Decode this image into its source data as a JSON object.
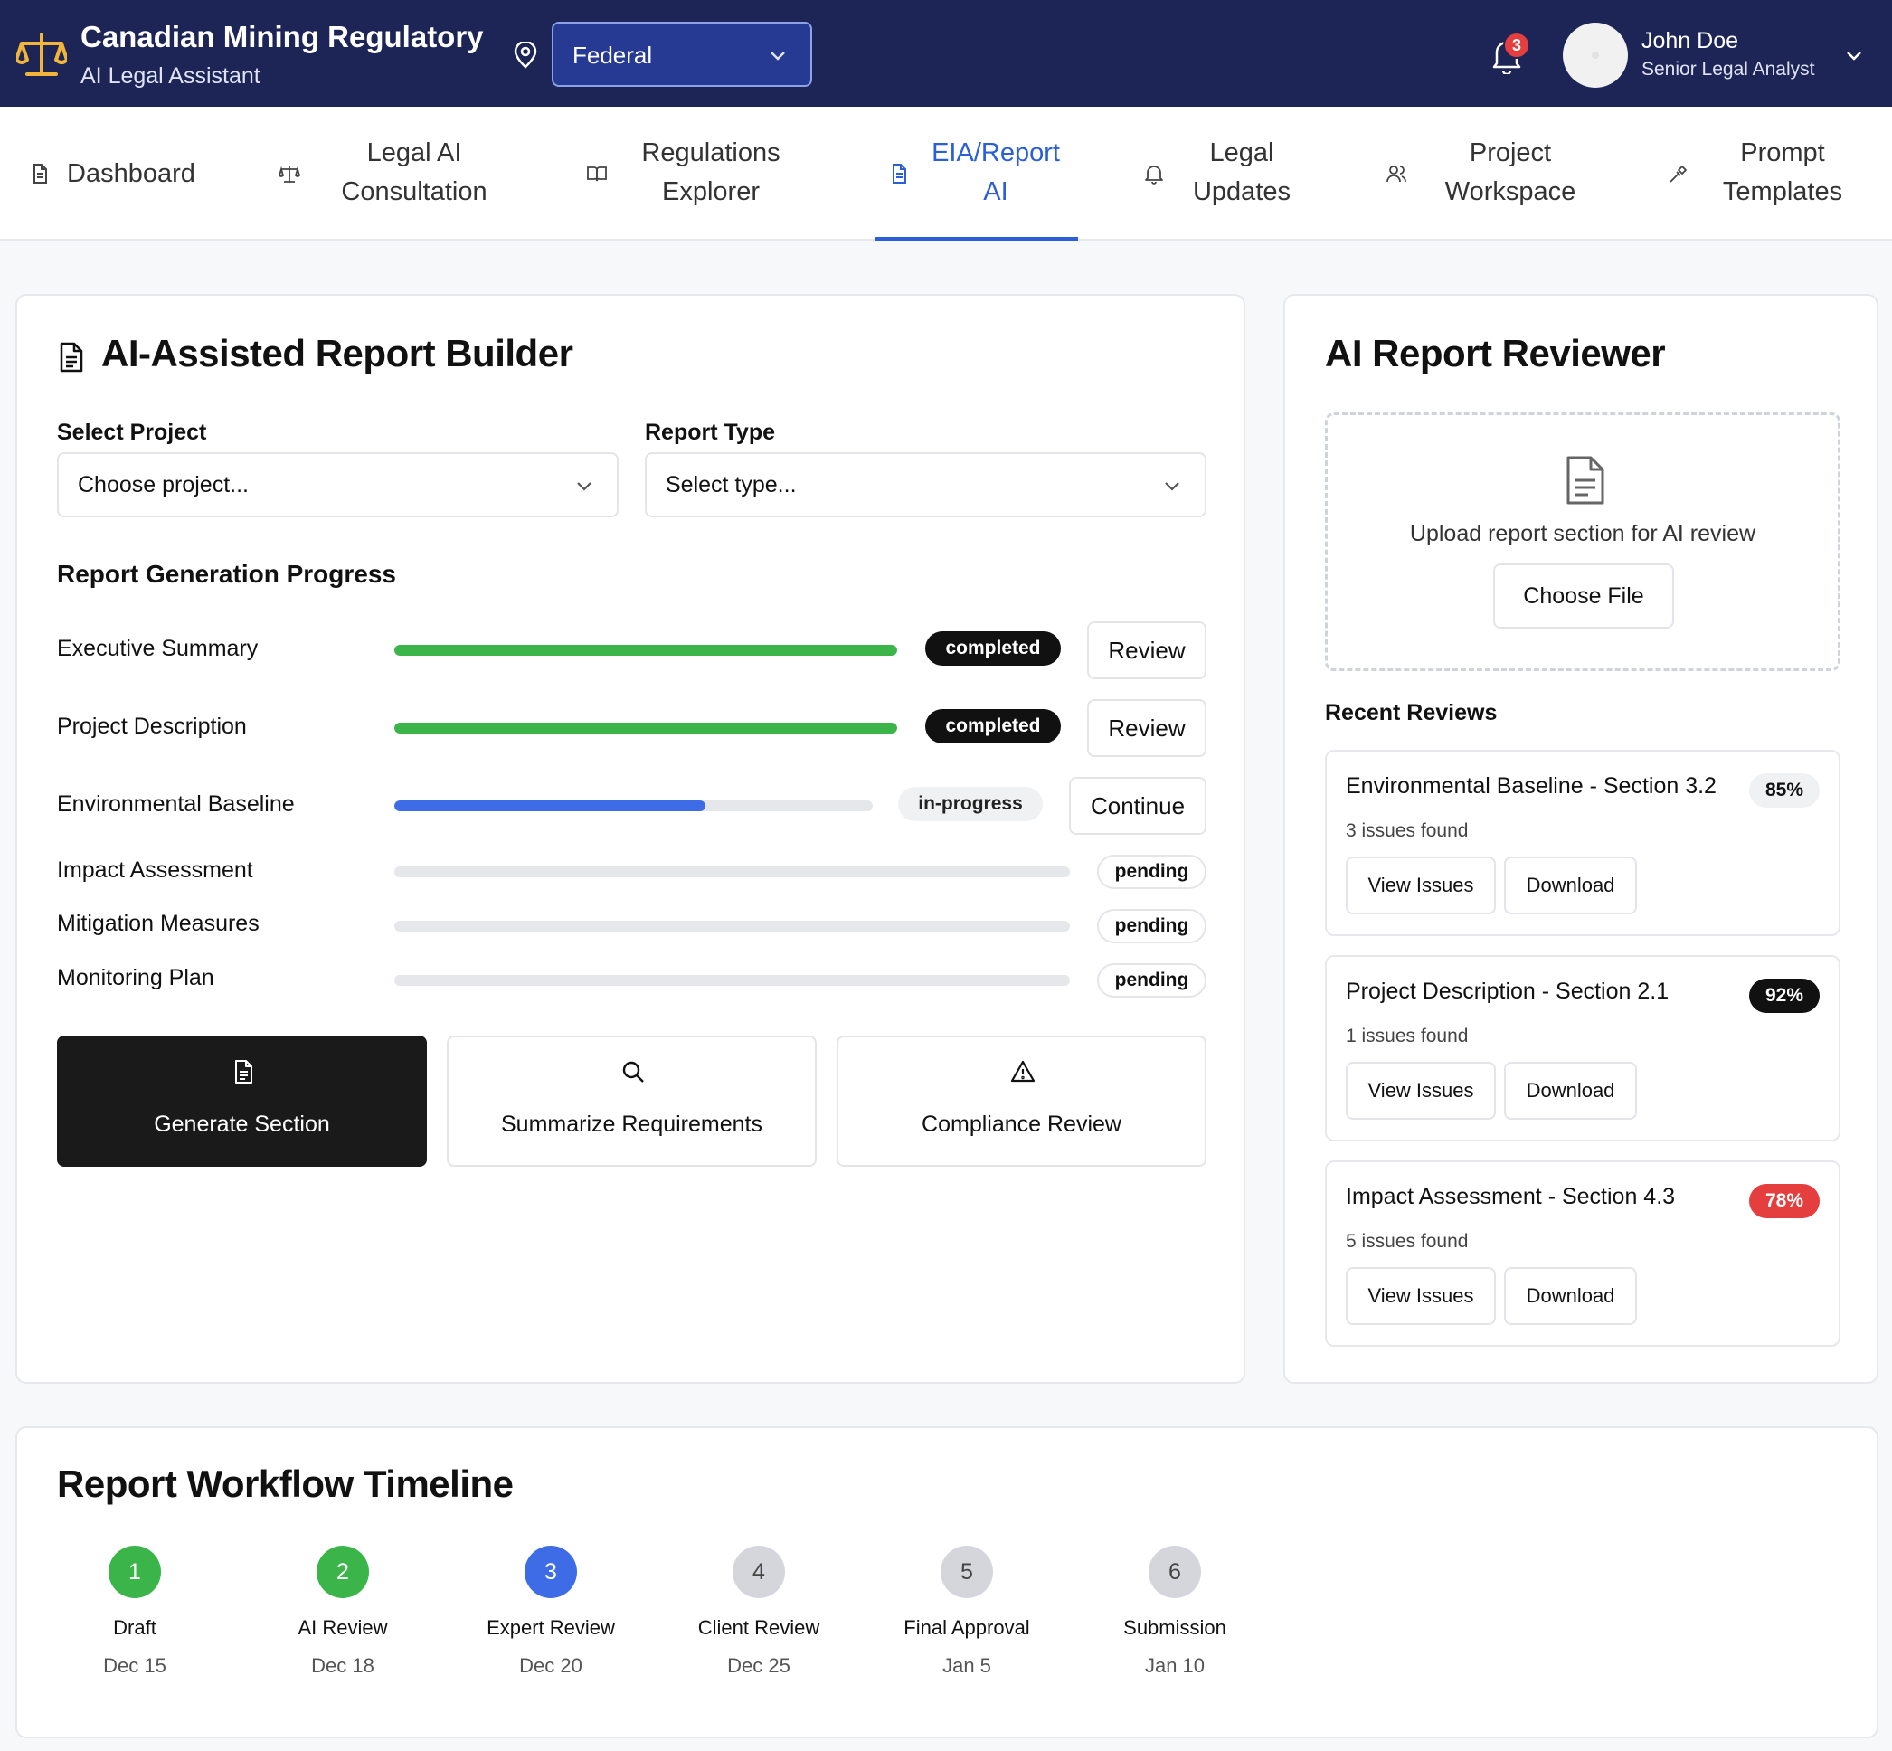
{
  "header": {
    "app_title": "Canadian Mining Regulatory",
    "app_subtitle": "AI Legal Assistant",
    "jurisdiction": "Federal",
    "notification_count": "3",
    "user_name": "John Doe",
    "user_role": "Senior Legal Analyst",
    "brand_color": "#1d2557",
    "logo_color": "#f2b53a"
  },
  "nav": {
    "tabs": [
      {
        "line1": "Dashboard",
        "line2": "",
        "icon": "file-text-icon"
      },
      {
        "line1": "Legal AI",
        "line2": "Consultation",
        "icon": "scale-icon"
      },
      {
        "line1": "Regulations",
        "line2": "Explorer",
        "icon": "book-open-icon"
      },
      {
        "line1": "EIA/Report",
        "line2": "AI",
        "icon": "file-text-icon"
      },
      {
        "line1": "Legal",
        "line2": "Updates",
        "icon": "bell-icon"
      },
      {
        "line1": "Project",
        "line2": "Workspace",
        "icon": "users-icon"
      },
      {
        "line1": "Prompt",
        "line2": "Templates",
        "icon": "wand-icon"
      }
    ],
    "active_tab": "EIA/Report AI",
    "accent_color": "#2b5fd9"
  },
  "builder": {
    "title": "AI-Assisted Report Builder",
    "project_label": "Select Project",
    "project_value": "Choose project...",
    "type_label": "Report Type",
    "type_value": "Select type...",
    "progress_heading": "Report Generation Progress",
    "sections": [
      {
        "name": "Executive Summary",
        "progress": 100,
        "status": "completed",
        "action": "Review"
      },
      {
        "name": "Project Description",
        "progress": 100,
        "status": "completed",
        "action": "Review"
      },
      {
        "name": "Environmental Baseline",
        "progress": 65,
        "status": "in-progress",
        "action": "Continue"
      },
      {
        "name": "Impact Assessment",
        "progress": 0,
        "status": "pending",
        "action": ""
      },
      {
        "name": "Mitigation Measures",
        "progress": 0,
        "status": "pending",
        "action": ""
      },
      {
        "name": "Monitoring Plan",
        "progress": 0,
        "status": "pending",
        "action": ""
      }
    ],
    "actions": [
      {
        "label": "Generate Section",
        "icon": "file-text-icon"
      },
      {
        "label": "Summarize Requirements",
        "icon": "search-icon"
      },
      {
        "label": "Compliance Review",
        "icon": "alert-triangle-icon"
      }
    ],
    "colors": {
      "completed": "#3bb54a",
      "in_progress": "#3d6ce6"
    }
  },
  "reviewer": {
    "title": "AI Report Reviewer",
    "upload_text": "Upload report section for AI review",
    "choose_file": "Choose File",
    "recent_heading": "Recent Reviews",
    "reviews": [
      {
        "title": "Environmental Baseline - Section 3.2",
        "score": "85%",
        "issues": "3 issues found",
        "view": "View Issues",
        "download": "Download"
      },
      {
        "title": "Project Description - Section 2.1",
        "score": "92%",
        "issues": "1 issues found",
        "view": "View Issues",
        "download": "Download"
      },
      {
        "title": "Impact Assessment - Section 4.3",
        "score": "78%",
        "issues": "5 issues found",
        "view": "View Issues",
        "download": "Download"
      }
    ]
  },
  "timeline": {
    "title": "Report Workflow Timeline",
    "steps": [
      {
        "num": "1",
        "name": "Draft",
        "date": "Dec 15",
        "state": "done"
      },
      {
        "num": "2",
        "name": "AI Review",
        "date": "Dec 18",
        "state": "done"
      },
      {
        "num": "3",
        "name": "Expert Review",
        "date": "Dec 20",
        "state": "current"
      },
      {
        "num": "4",
        "name": "Client Review",
        "date": "Dec 25",
        "state": "future"
      },
      {
        "num": "5",
        "name": "Final Approval",
        "date": "Jan 5",
        "state": "future"
      },
      {
        "num": "6",
        "name": "Submission",
        "date": "Jan 10",
        "state": "future"
      }
    ]
  }
}
